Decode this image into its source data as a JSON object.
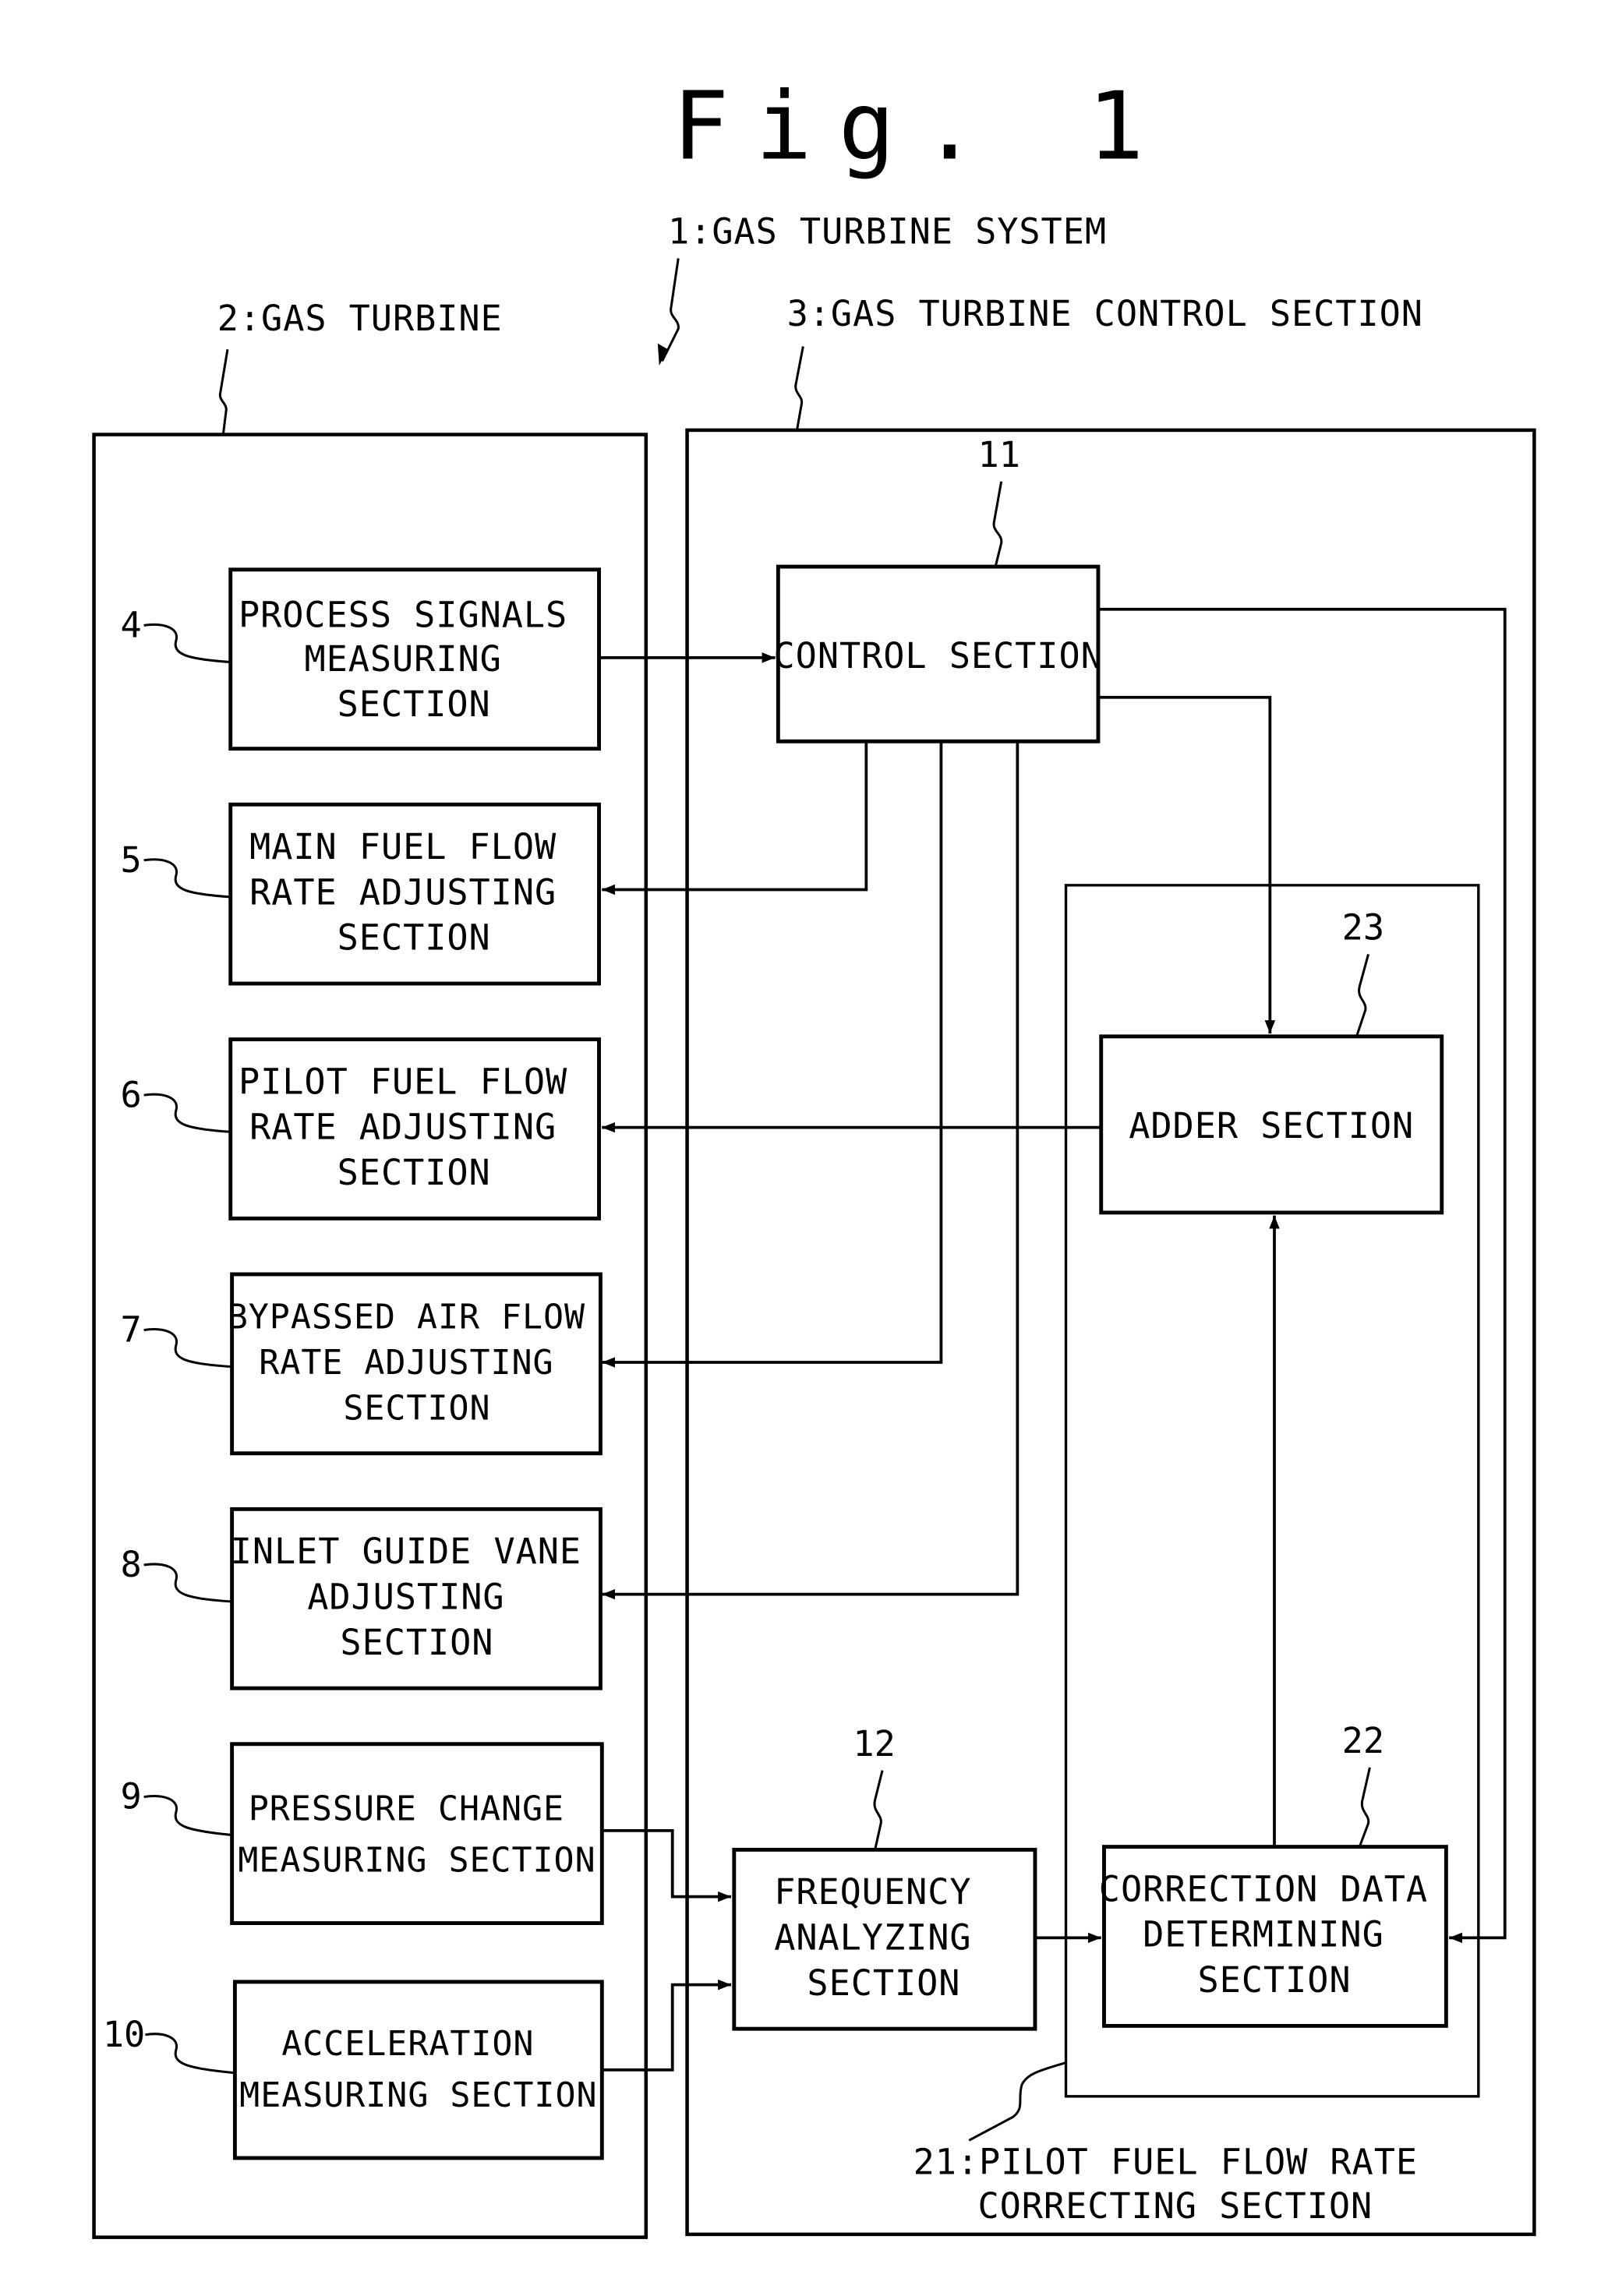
{
  "figure": {
    "title": "Fig. 1",
    "system_label": "1:GAS TURBINE SYSTEM",
    "gas_turbine_label": "2:GAS TURBINE",
    "control_section_label": "3:GAS TURBINE CONTROL SECTION",
    "correcting_section_label": [
      "21:PILOT FUEL FLOW RATE",
      "CORRECTING SECTION"
    ]
  },
  "gas_turbine_blocks": [
    {
      "ref": "4",
      "lines": [
        "PROCESS SIGNALS",
        "MEASURING",
        "SECTION"
      ]
    },
    {
      "ref": "5",
      "lines": [
        "MAIN FUEL FLOW",
        "RATE ADJUSTING",
        "SECTION"
      ]
    },
    {
      "ref": "6",
      "lines": [
        "PILOT FUEL FLOW",
        "RATE ADJUSTING",
        "SECTION"
      ]
    },
    {
      "ref": "7",
      "lines": [
        "BYPASSED AIR FLOW",
        "RATE ADJUSTING",
        "SECTION"
      ]
    },
    {
      "ref": "8",
      "lines": [
        "INLET GUIDE VANE",
        "ADJUSTING",
        "SECTION"
      ]
    },
    {
      "ref": "9",
      "lines": [
        "PRESSURE CHANGE",
        "MEASURING SECTION"
      ]
    },
    {
      "ref": "10",
      "lines": [
        "ACCELERATION",
        "MEASURING SECTION"
      ]
    }
  ],
  "control_blocks": {
    "control": {
      "ref": "11",
      "lines": [
        "CONTROL SECTION"
      ]
    },
    "frequency": {
      "ref": "12",
      "lines": [
        "FREQUENCY",
        "ANALYZING",
        "SECTION"
      ]
    },
    "correction": {
      "ref": "22",
      "lines": [
        "CORRECTION DATA",
        "DETERMINING",
        "SECTION"
      ]
    },
    "adder": {
      "ref": "23",
      "lines": [
        "ADDER SECTION"
      ]
    }
  }
}
